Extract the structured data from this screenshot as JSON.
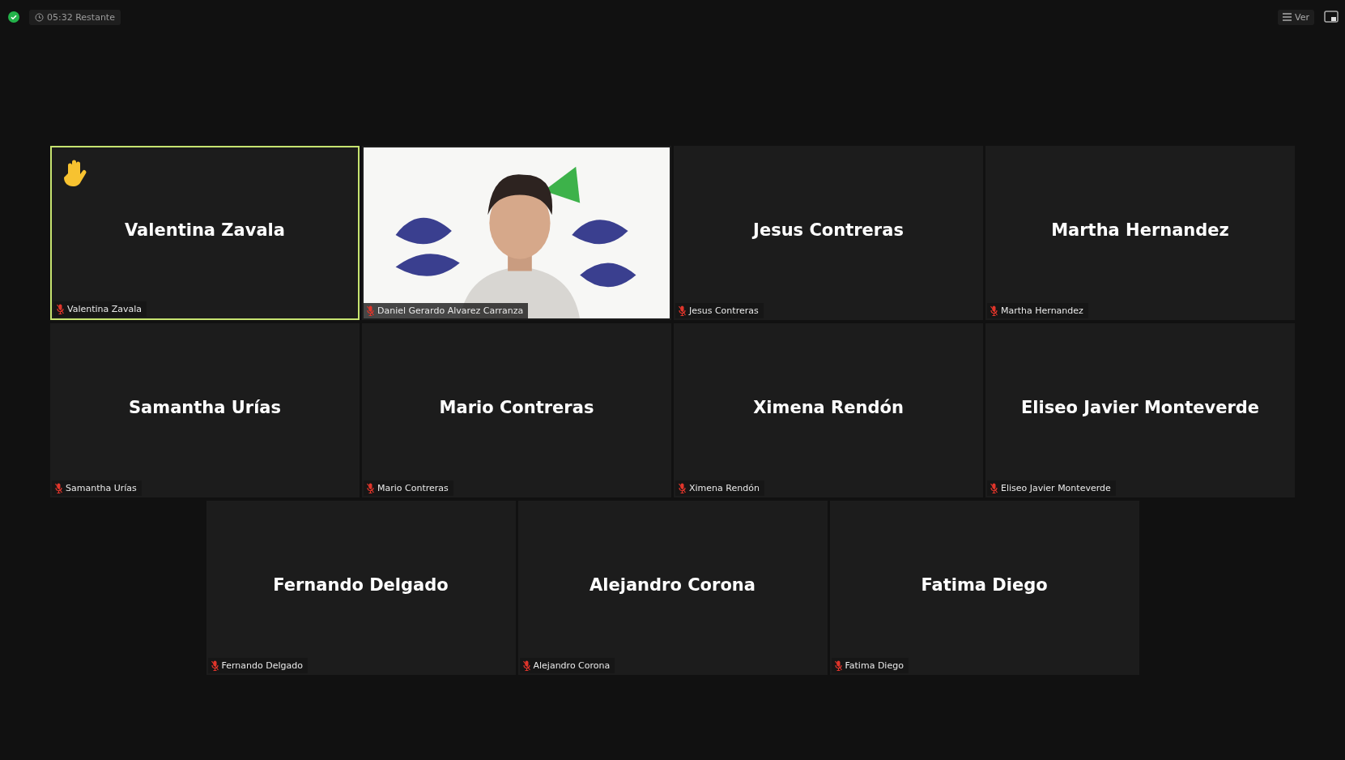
{
  "status": {
    "timer": "05:32 Restante"
  },
  "view_button": {
    "label": "Ver"
  },
  "tiles": [
    {
      "kind": "name",
      "name": "Valentina Zavala",
      "label": "Valentina Zavala",
      "muted": true,
      "hand_raised": true,
      "active": true
    },
    {
      "kind": "video",
      "label": "Daniel Gerardo Alvarez Carranza",
      "muted": true,
      "hand_raised": false,
      "active": false
    },
    {
      "kind": "name",
      "name": "Jesus Contreras",
      "label": "Jesus Contreras",
      "muted": true,
      "hand_raised": false,
      "active": false
    },
    {
      "kind": "name",
      "name": "Martha Hernandez",
      "label": "Martha Hernandez",
      "muted": true,
      "hand_raised": false,
      "active": false
    },
    {
      "kind": "name",
      "name": "Samantha Urías",
      "label": "Samantha Urías",
      "muted": true,
      "hand_raised": false,
      "active": false
    },
    {
      "kind": "name",
      "name": "Mario Contreras",
      "label": "Mario Contreras",
      "muted": true,
      "hand_raised": false,
      "active": false
    },
    {
      "kind": "name",
      "name": "Ximena Rendón",
      "label": "Ximena Rendón",
      "muted": true,
      "hand_raised": false,
      "active": false
    },
    {
      "kind": "name",
      "name": "Eliseo Javier Monteverde",
      "label": "Eliseo Javier Monteverde",
      "muted": true,
      "hand_raised": false,
      "active": false
    },
    {
      "kind": "name",
      "name": "Fernando Delgado",
      "label": "Fernando Delgado",
      "muted": true,
      "hand_raised": false,
      "active": false
    },
    {
      "kind": "name",
      "name": "Alejandro Corona",
      "label": "Alejandro Corona",
      "muted": true,
      "hand_raised": false,
      "active": false
    },
    {
      "kind": "name",
      "name": "Fatima Diego",
      "label": "Fatima Diego",
      "muted": true,
      "hand_raised": false,
      "active": false
    }
  ]
}
